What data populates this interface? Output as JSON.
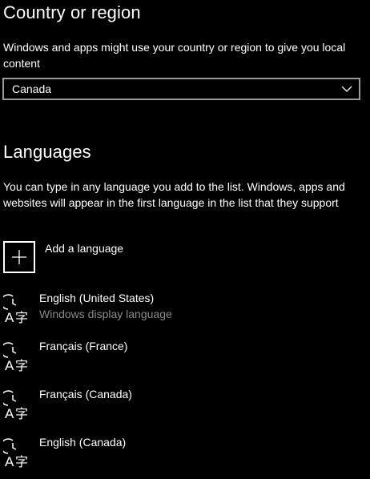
{
  "region": {
    "title": "Country or region",
    "description": "Windows and apps might use your country or region to give you local content",
    "selected": "Canada"
  },
  "languages": {
    "title": "Languages",
    "description": "You can type in any language you add to the list. Windows, apps and websites will appear in the first language in the list that they support",
    "add_label": "Add a language",
    "items": [
      {
        "name": "English (United States)",
        "sub": "Windows display language"
      },
      {
        "name": "Français (France)",
        "sub": ""
      },
      {
        "name": "Français (Canada)",
        "sub": ""
      },
      {
        "name": "English (Canada)",
        "sub": ""
      }
    ]
  },
  "icons": {
    "dropdown": "chevron-down-icon",
    "add": "plus-icon",
    "language": "language-icon"
  },
  "colors": {
    "background": "#000000",
    "text": "#ffffff",
    "secondary_text": "#8a8a8a",
    "border": "#9a9a9a"
  }
}
